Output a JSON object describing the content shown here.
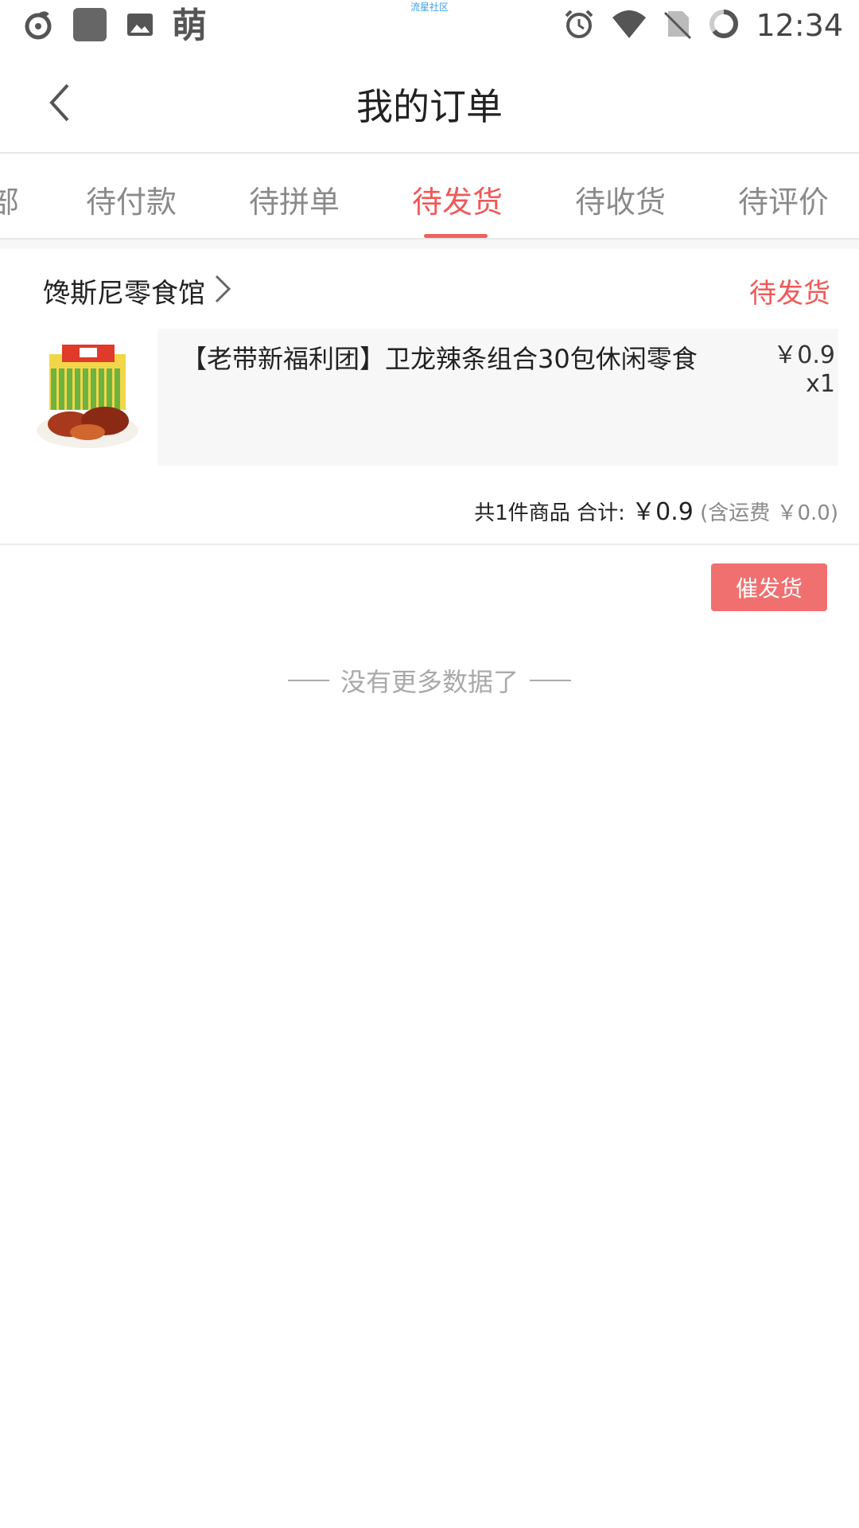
{
  "status_bar": {
    "app_label": "流星社区",
    "left_char": "萌",
    "time": "12:34",
    "icons": [
      "netease-music-icon",
      "app-square-icon",
      "image-icon",
      "alarm-icon",
      "wifi-icon",
      "no-sim-icon",
      "battery-icon"
    ]
  },
  "header": {
    "title": "我的订单",
    "back_icon": "chevron-left-icon"
  },
  "tabs": [
    {
      "label": "部"
    },
    {
      "label": "待付款"
    },
    {
      "label": "待拼单"
    },
    {
      "label": "待发货",
      "active": true
    },
    {
      "label": "待收货"
    },
    {
      "label": "待评价"
    }
  ],
  "order": {
    "shop_name": "馋斯尼零食馆",
    "status": "待发货",
    "item": {
      "title": "【老带新福利团】卫龙辣条组合30包休闲零食",
      "price": "￥0.9",
      "quantity": "x1"
    },
    "summary": {
      "count_text": "共1件商品 合计:",
      "total": "￥0.9",
      "shipping": "(含运费 ￥0.0)"
    },
    "action_button": "催发货"
  },
  "footer_text": "没有更多数据了",
  "colors": {
    "accent": "#f25757",
    "button": "#f07070"
  }
}
